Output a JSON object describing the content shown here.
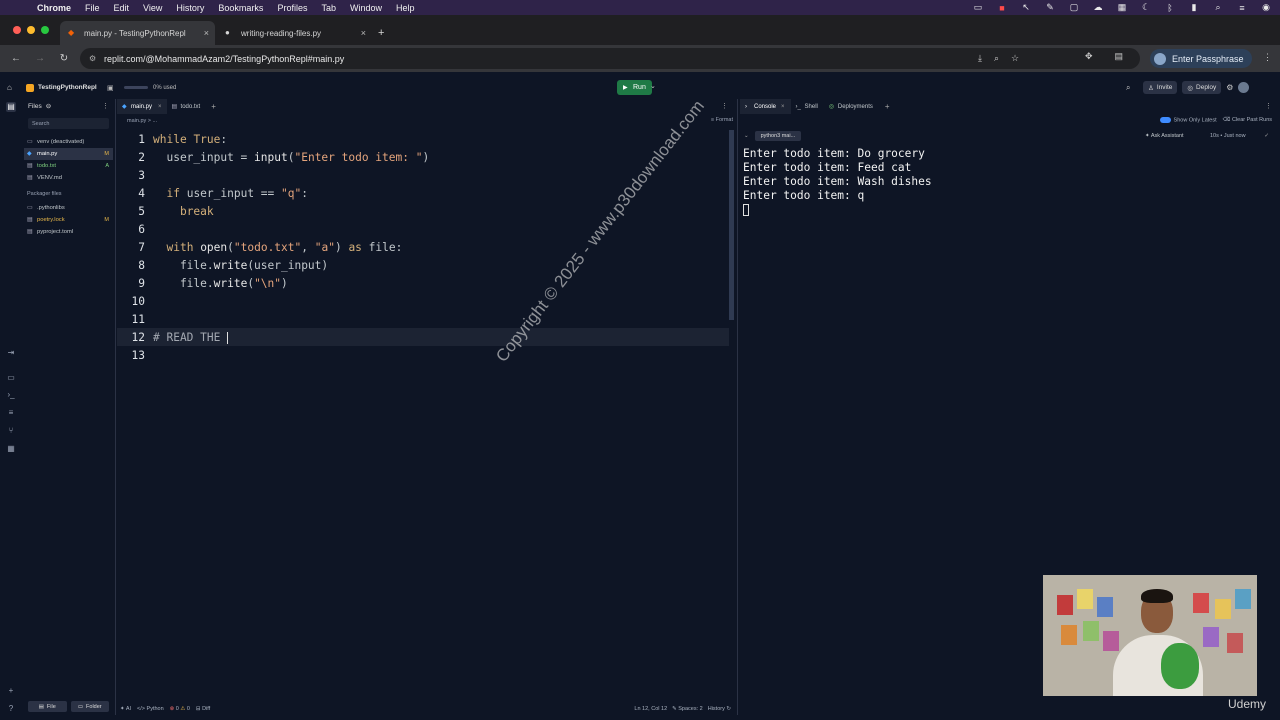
{
  "macos": {
    "app_name": "Chrome",
    "menu": [
      "File",
      "Edit",
      "View",
      "History",
      "Bookmarks",
      "Profiles",
      "Tab",
      "Window",
      "Help"
    ]
  },
  "chrome": {
    "tabs": [
      {
        "title": "main.py - TestingPythonRepl",
        "active": true
      },
      {
        "title": "writing-reading-files.py",
        "active": false
      }
    ],
    "url": "replit.com/@MohammadAzam2/TestingPythonRepl#main.py",
    "profile_button": "Enter Passphrase"
  },
  "replit": {
    "project_name": "TestingPythonRepl",
    "usage": "0% used",
    "run_label": "Run",
    "invite_label": "Invite",
    "deploy_label": "Deploy"
  },
  "files": {
    "title": "Files",
    "search_placeholder": "Search",
    "items": [
      {
        "name": "venv (deactivated)",
        "badge": "",
        "selected": false
      },
      {
        "name": "main.py",
        "badge": "M",
        "selected": true
      },
      {
        "name": "todo.txt",
        "badge": "A",
        "selected": false
      },
      {
        "name": "VENV.md",
        "badge": "",
        "selected": false
      }
    ],
    "packager_label": "Packager files",
    "packager_items": [
      {
        "name": ".pythonlibs",
        "badge": ""
      },
      {
        "name": "poetry.lock",
        "badge": "M"
      },
      {
        "name": "pyproject.toml",
        "badge": ""
      }
    ],
    "add_file": "File",
    "add_folder": "Folder"
  },
  "editor": {
    "tabs": [
      "main.py",
      "todo.txt"
    ],
    "breadcrumb": "main.py > ...",
    "format_label": "Format",
    "lines": [
      "while True:",
      "  user_input = input(\"Enter todo item: \")",
      "",
      "  if user_input == \"q\":",
      "    break",
      "",
      "  with open(\"todo.txt\", \"a\") as file:",
      "    file.write(user_input)",
      "    file.write(\"\\n\")",
      "",
      "",
      "# READ THE ",
      ""
    ],
    "current_line": 12,
    "status_left": "AI",
    "status_lang": "Python",
    "status_errors": "0",
    "status_warnings": "0",
    "status_diff": "Diff",
    "status_pos": "Ln 12, Col 12",
    "status_spaces": "Spaces: 2",
    "status_history": "History"
  },
  "console": {
    "tabs": [
      "Console",
      "Shell",
      "Deployments"
    ],
    "show_only_latest": "Show Only Latest",
    "clear_past_runs": "Clear Past Runs",
    "run_chip": "python3 mai...",
    "ask_assistant": "Ask Assistant",
    "run_time": "10s • Just now",
    "output": [
      "Enter todo item: Do grocery",
      "Enter todo item: Feed cat",
      "Enter todo item: Wash dishes",
      "Enter todo item: q"
    ]
  },
  "watermark": "Copyright © 2025 - www.p30download.com",
  "brand": "Udemy",
  "colors": {
    "run_green": "#1f7a46",
    "menubar": "#2f2349",
    "ide_bg": "#0e1525",
    "keyword": "#d4b07a",
    "string": "#e4a47c"
  }
}
